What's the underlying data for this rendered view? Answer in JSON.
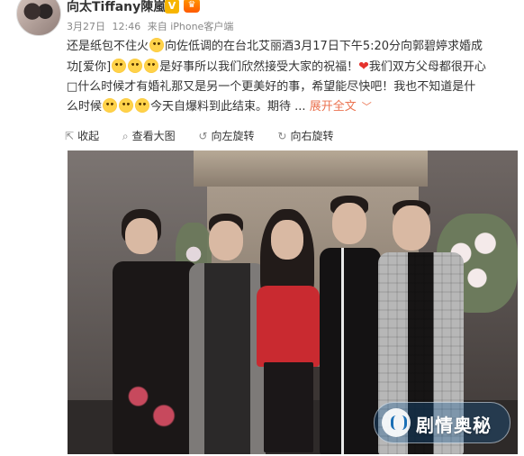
{
  "post": {
    "author": "向太Tiffany陳嵐",
    "verified_badge": "V",
    "meta": {
      "date": "3月27日",
      "time": "12:46",
      "source": "来自 iPhone客户端"
    },
    "content": {
      "line1": "还是纸包不住火",
      "line1b": "向佐低调的在台北艾丽酒3月17日下午5:20分向郭碧婷求婚成",
      "line2a": "功[爱你]",
      "line2b": "是好事所以我们欣然接受大家的祝福！",
      "line2c": "我们双方父母都很开心",
      "line3": "□什么时候才有婚礼那又是另一个更美好的事，希望能尽快吧！我也不知道是什",
      "line4a": "么时候",
      "line4b": "今天自爆料到此结束。期待 ...",
      "expand_label": "展开全文"
    },
    "actions": [
      {
        "label": "收起",
        "icon": "collapse-icon"
      },
      {
        "label": "查看大图",
        "icon": "zoom-icon"
      },
      {
        "label": "向左旋转",
        "icon": "rotate-left-icon"
      },
      {
        "label": "向右旋转",
        "icon": "rotate-right-icon"
      }
    ],
    "watermark": {
      "text": "剧情奥秘",
      "icon": "logo-icon"
    },
    "colors": {
      "link": "#eb7350",
      "meta": "#888888",
      "text": "#333333",
      "heart": "#e5322d",
      "verified": "#f7b500"
    }
  }
}
